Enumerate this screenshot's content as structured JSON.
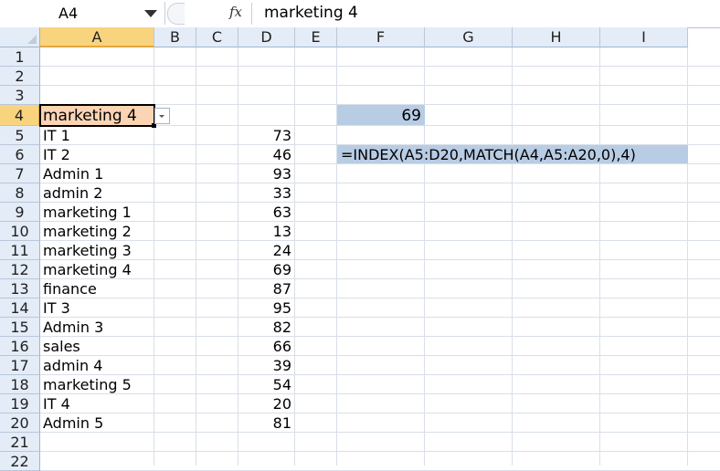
{
  "formula_bar": {
    "name_box": "A4",
    "fx_label": "fx",
    "content": "marketing 4"
  },
  "columns": [
    "A",
    "B",
    "C",
    "D",
    "E",
    "F",
    "G",
    "H",
    "I"
  ],
  "rows": [
    "1",
    "2",
    "3",
    "4",
    "5",
    "6",
    "7",
    "8",
    "9",
    "10",
    "11",
    "12",
    "13",
    "14",
    "15",
    "16",
    "17",
    "18",
    "19",
    "20",
    "21",
    "22"
  ],
  "active_cell": "A4",
  "cells": {
    "A4": "marketing 4",
    "F4": "69",
    "F6": "=INDEX(A5:D20,MATCH(A4,A5:A20,0),4)"
  },
  "table": [
    {
      "name": "IT 1",
      "value": "73"
    },
    {
      "name": "IT 2",
      "value": "46"
    },
    {
      "name": "Admin 1",
      "value": "93"
    },
    {
      "name": "admin 2",
      "value": "33"
    },
    {
      "name": "marketing 1",
      "value": "63"
    },
    {
      "name": "marketing 2",
      "value": "13"
    },
    {
      "name": "marketing 3",
      "value": "24"
    },
    {
      "name": "marketing 4",
      "value": "69"
    },
    {
      "name": "finance",
      "value": "87"
    },
    {
      "name": "IT 3",
      "value": "95"
    },
    {
      "name": "Admin 3",
      "value": "82"
    },
    {
      "name": "sales",
      "value": "66"
    },
    {
      "name": "admin 4",
      "value": "39"
    },
    {
      "name": "marketing 5",
      "value": "54"
    },
    {
      "name": "IT 4",
      "value": "20"
    },
    {
      "name": "Admin 5",
      "value": "81"
    }
  ],
  "colors": {
    "selected_cell_fill": "#fbd4b4",
    "result_fill": "#b8cce4",
    "header_active": "#f9d47e"
  }
}
